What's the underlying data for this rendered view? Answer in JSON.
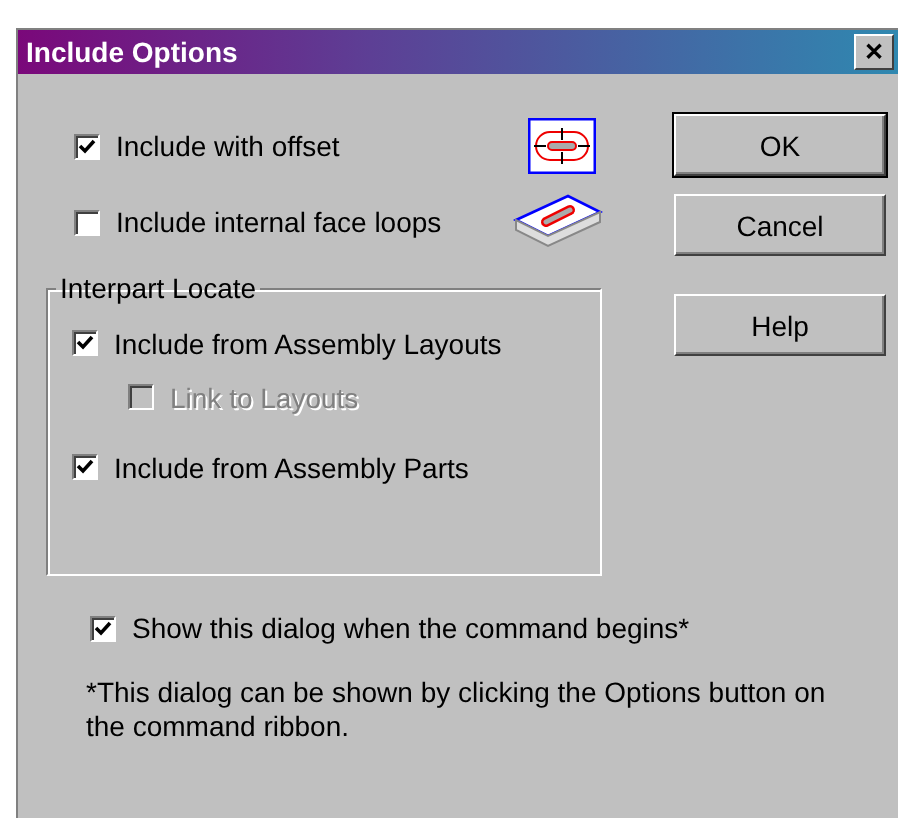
{
  "window": {
    "title": "Include Options",
    "close": "✕"
  },
  "options": [
    {
      "label": "Include with offset",
      "checked": true,
      "disabled": false
    },
    {
      "label": "Include internal face loops",
      "checked": false,
      "disabled": false
    }
  ],
  "group": {
    "title": "Interpart Locate",
    "items": [
      {
        "label": "Include from Assembly Layouts",
        "checked": true,
        "disabled": false,
        "indented": false
      },
      {
        "label": "Link to Layouts",
        "checked": false,
        "disabled": true,
        "indented": true
      },
      {
        "label": "Include from Assembly Parts",
        "checked": true,
        "disabled": false,
        "indented": false
      }
    ]
  },
  "buttons": [
    {
      "label": "OK",
      "default": true
    },
    {
      "label": "Cancel",
      "default": false
    },
    {
      "label": "Help",
      "default": false
    }
  ],
  "show_dialog": {
    "label": "Show this dialog when the command begins*",
    "checked": true,
    "disabled": false
  },
  "footnote": "*This dialog can be shown by clicking the Options button on the command ribbon."
}
